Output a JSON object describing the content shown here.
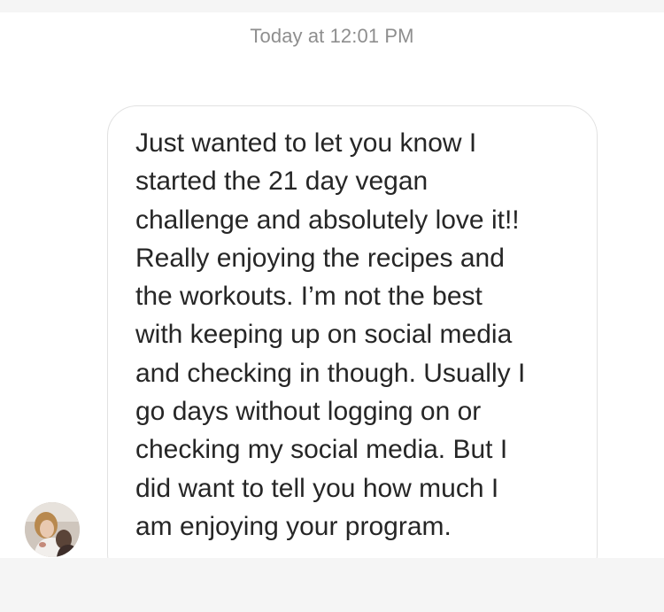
{
  "thread": {
    "timestamp": "Today at 12:01 PM"
  },
  "message": {
    "text": "Just wanted to let you know I\nstarted the 21 day vegan\nchallenge and absolutely love it!!\nReally enjoying the recipes and\nthe workouts. I’m not the best\nwith keeping up on social media\nand checking in though. Usually I\ngo days without logging on or\nchecking my social media. But I\ndid want to tell you how much I\nam enjoying your program."
  },
  "colors": {
    "background": "#ffffff",
    "strip": "#f5f5f5",
    "timestamp": "#8e8e8e",
    "bubble_border": "#e2e2e2",
    "message_text": "#262626"
  },
  "icons": {
    "avatar": "sender-avatar-photo"
  }
}
